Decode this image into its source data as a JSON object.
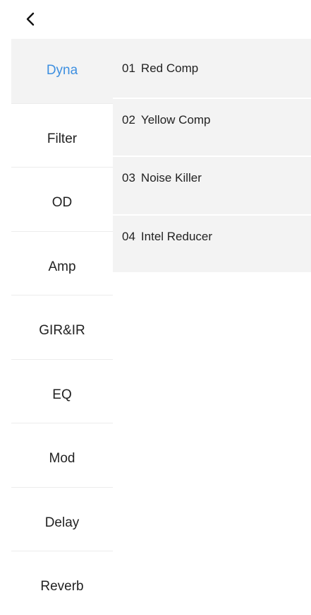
{
  "nav": {
    "back_icon": "chevron-left-icon"
  },
  "sidebar": {
    "active_index": 0,
    "items": [
      {
        "label": "Dyna"
      },
      {
        "label": "Filter"
      },
      {
        "label": "OD"
      },
      {
        "label": "Amp"
      },
      {
        "label": "GIR&IR"
      },
      {
        "label": "EQ"
      },
      {
        "label": "Mod"
      },
      {
        "label": "Delay"
      },
      {
        "label": "Reverb"
      }
    ]
  },
  "effects": [
    {
      "number": "01",
      "name": "Red Comp"
    },
    {
      "number": "02",
      "name": "Yellow Comp"
    },
    {
      "number": "03",
      "name": "Noise Killer"
    },
    {
      "number": "04",
      "name": "Intel Reducer"
    }
  ],
  "colors": {
    "accent": "#3d8fe0",
    "active_bg": "#f3f3f3",
    "text": "#222222"
  }
}
